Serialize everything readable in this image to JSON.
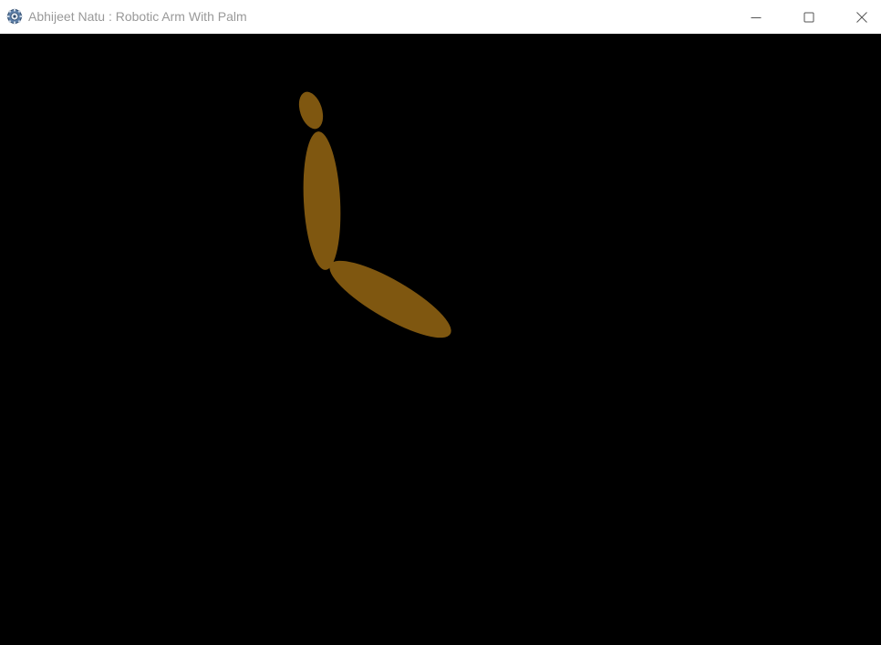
{
  "window": {
    "title": "Abhijeet Natu : Robotic Arm With Palm",
    "app_icon": "opengl-gear-icon",
    "controls": [
      "minimize-icon",
      "maximize-icon",
      "close-icon"
    ]
  },
  "scene": {
    "background_color": "#000000",
    "arm_color": "#7f5710",
    "segments": [
      "upper-arm",
      "forearm",
      "palm"
    ]
  }
}
